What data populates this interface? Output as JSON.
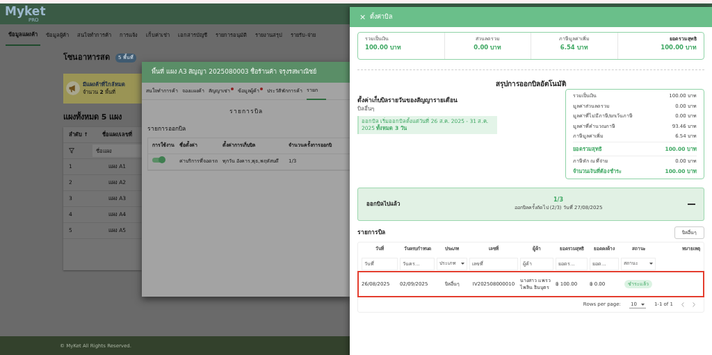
{
  "app": {
    "logo": "Myket",
    "logo_sub": "PRO",
    "nav_tabs": [
      {
        "label": "ข้อมูลแผงค้า",
        "selected": true
      },
      {
        "label": "ข้อมูลผู้ค้า",
        "selected": false
      },
      {
        "label": "สนใจทำการค้า",
        "selected": false
      },
      {
        "label": "การแจ้ง",
        "selected": false
      },
      {
        "label": "เก็บค่าเช่า",
        "selected": false
      },
      {
        "label": "เอกสารบัญชี",
        "selected": false
      },
      {
        "label": "รายการอนุมัติ",
        "selected": false
      },
      {
        "label": "รายงานสรุป",
        "selected": false
      },
      {
        "label": "รายรับ-จ่าย",
        "selected": false
      }
    ],
    "zone_title": "โซนอาหารสด",
    "zone_badge": "5 พื้นที่",
    "alert": {
      "title": "มีแผงค้าที่ใกล้หมด",
      "text": "จำนวน **2** พื้นที่"
    },
    "stalls_heading": "แผงทั้งหมด 5 แผง",
    "stalls_table": {
      "columns": [
        "ลำดับ ↑",
        "ชื่อแผง/เลขที่"
      ],
      "filter_placeholder": "ชื่อแผง",
      "rows": [
        [
          "1",
          "แผง A1"
        ],
        [
          "2",
          "แผง A2"
        ],
        [
          "3",
          "แผง A3"
        ],
        [
          "4",
          "แผง A4"
        ],
        [
          "5",
          "แผง A5"
        ]
      ]
    },
    "footer": "© MyKet All Rights Reserved."
  },
  "modal": {
    "title": "พื้นที่ แผง A3 สัญญา 2025080003 ชื่อร้านค้า จรุงรสพาณิชย์",
    "tabs": [
      {
        "label": "สนใจทำการค้า",
        "selected": false,
        "dot": false
      },
      {
        "label": "จองแผงค้า",
        "selected": false,
        "dot": false
      },
      {
        "label": "สัญญาเช่า",
        "selected": false,
        "dot": true
      },
      {
        "label": "ข้อมูลผู้ค้า",
        "selected": false,
        "dot": true
      },
      {
        "label": "ประวัติพักการค้า",
        "selected": false,
        "dot": false
      },
      {
        "label": "รายก",
        "selected": true,
        "dot": false
      }
    ],
    "section_title": "รายการบิล",
    "subtitle": "รายการออกบิล",
    "columns": [
      "การใช้งาน",
      "ชื่อตั้งค่า",
      "ตั้งค่าการเก็บบิล",
      "จำนวนครั้งการออกบิ"
    ],
    "rows": [
      {
        "enabled": true,
        "name": "ค่าบริการที่จอดรถ",
        "schedule": "ทุกวัน อังคาร,พุธ,พฤหัสบดี",
        "count": "1/3"
      }
    ]
  },
  "drawer": {
    "title": "ตั้งค่าบิล",
    "close": "×",
    "totals": [
      {
        "label": "รวมเป็นเงิน",
        "value": "100.00 บาท",
        "bold": false
      },
      {
        "label": "ส่วนลดรวม",
        "value": "0.00 บาท",
        "bold": false
      },
      {
        "label": "ภาษีมูลค่าเพิ่ม",
        "value": "6.54 บาท",
        "bold": false
      },
      {
        "label": "ยอดรวมสุทธิ",
        "value": "100.00 บาท",
        "bold": true
      }
    ],
    "summary_title": "สรุปการออกบิลอัตโนมัติ",
    "setting_title": "ตั้งค่าเก็บบิลรายวันของสัญญารายเดือน",
    "setting_type": "บิลอื่นๆ",
    "setting_info": "ออกบิล เริ่มออกบิลตั้งแต่วันที่ 26 ส.ค. 2025 - 31 ส.ค. 2025 **ทั้งหมด 3 วัน**",
    "breakdown": [
      {
        "label": "รวมเป็นเงิน",
        "value": "100.00 บาท",
        "kind": "plain"
      },
      {
        "label": "มูลค่าส่วนลดรวม",
        "value": "0.00 บาท",
        "kind": "plain"
      },
      {
        "label": "มูลค่าที่ไม่มีภาษี/ยกเว้นภาษี",
        "value": "0.00 บาท",
        "kind": "plain"
      },
      {
        "label": "มูลค่าที่คำนวณภาษี",
        "value": "93.46 บาท",
        "kind": "plain"
      },
      {
        "label": "ภาษีมูลค่าเพิ่ม",
        "value": "6.54 บาท",
        "kind": "plain"
      },
      {
        "label": "ยอดรวมสุทธิ",
        "value": "100.00 บาท",
        "kind": "total"
      },
      {
        "label": "ภาษีหัก ณ ที่จ่าย",
        "value": "0.00 บาท",
        "kind": "plain"
      },
      {
        "label": "จำนวนเงินที่ต้องชำระ",
        "value": "100.00 บาท",
        "kind": "due"
      }
    ],
    "issued": {
      "title": "ออกบิลไปแล้ว",
      "count": "1/3",
      "next": "ออกบิลครั้งถัดไป (2/3) วันที่ 27/08/2025",
      "expanded": true
    },
    "bills_title": "รายการบิล",
    "bills_button": "บิลอื่นๆ",
    "bills_columns": [
      "วันที่",
      "วันครบกำหนด",
      "ประเภท",
      "เลขที่",
      "ผู้ค้า",
      "ยอดรวมสุทธิ",
      "ยอดคงค้าง",
      "สถานะ",
      "หมายเหตุ"
    ],
    "bills_filters": [
      {
        "placeholder": "วันที่",
        "kind": "text"
      },
      {
        "placeholder": "วันคร...",
        "kind": "text"
      },
      {
        "placeholder": "ประเภท",
        "kind": "select"
      },
      {
        "placeholder": "เลขที่",
        "kind": "text"
      },
      {
        "placeholder": "ผู้ค้า",
        "kind": "text"
      },
      {
        "placeholder": "ยอดร...",
        "kind": "text"
      },
      {
        "placeholder": "ยอด...",
        "kind": "text"
      },
      {
        "placeholder": "สถานะ",
        "kind": "select"
      }
    ],
    "bills_rows": [
      {
        "highlighted": true,
        "cells": [
          "26/08/2025",
          "02/09/2025",
          "บิลอื่นๆ",
          "IV202508000010",
          "นางสาว แพรวไพลิน ธินบุตร",
          "฿ 100.00",
          "฿ 0.00"
        ],
        "status": "ชำระแล้ว"
      }
    ],
    "pagination": {
      "rows_label": "Rows per page:",
      "rows_value": "10",
      "range": "1-1 of 1"
    }
  }
}
